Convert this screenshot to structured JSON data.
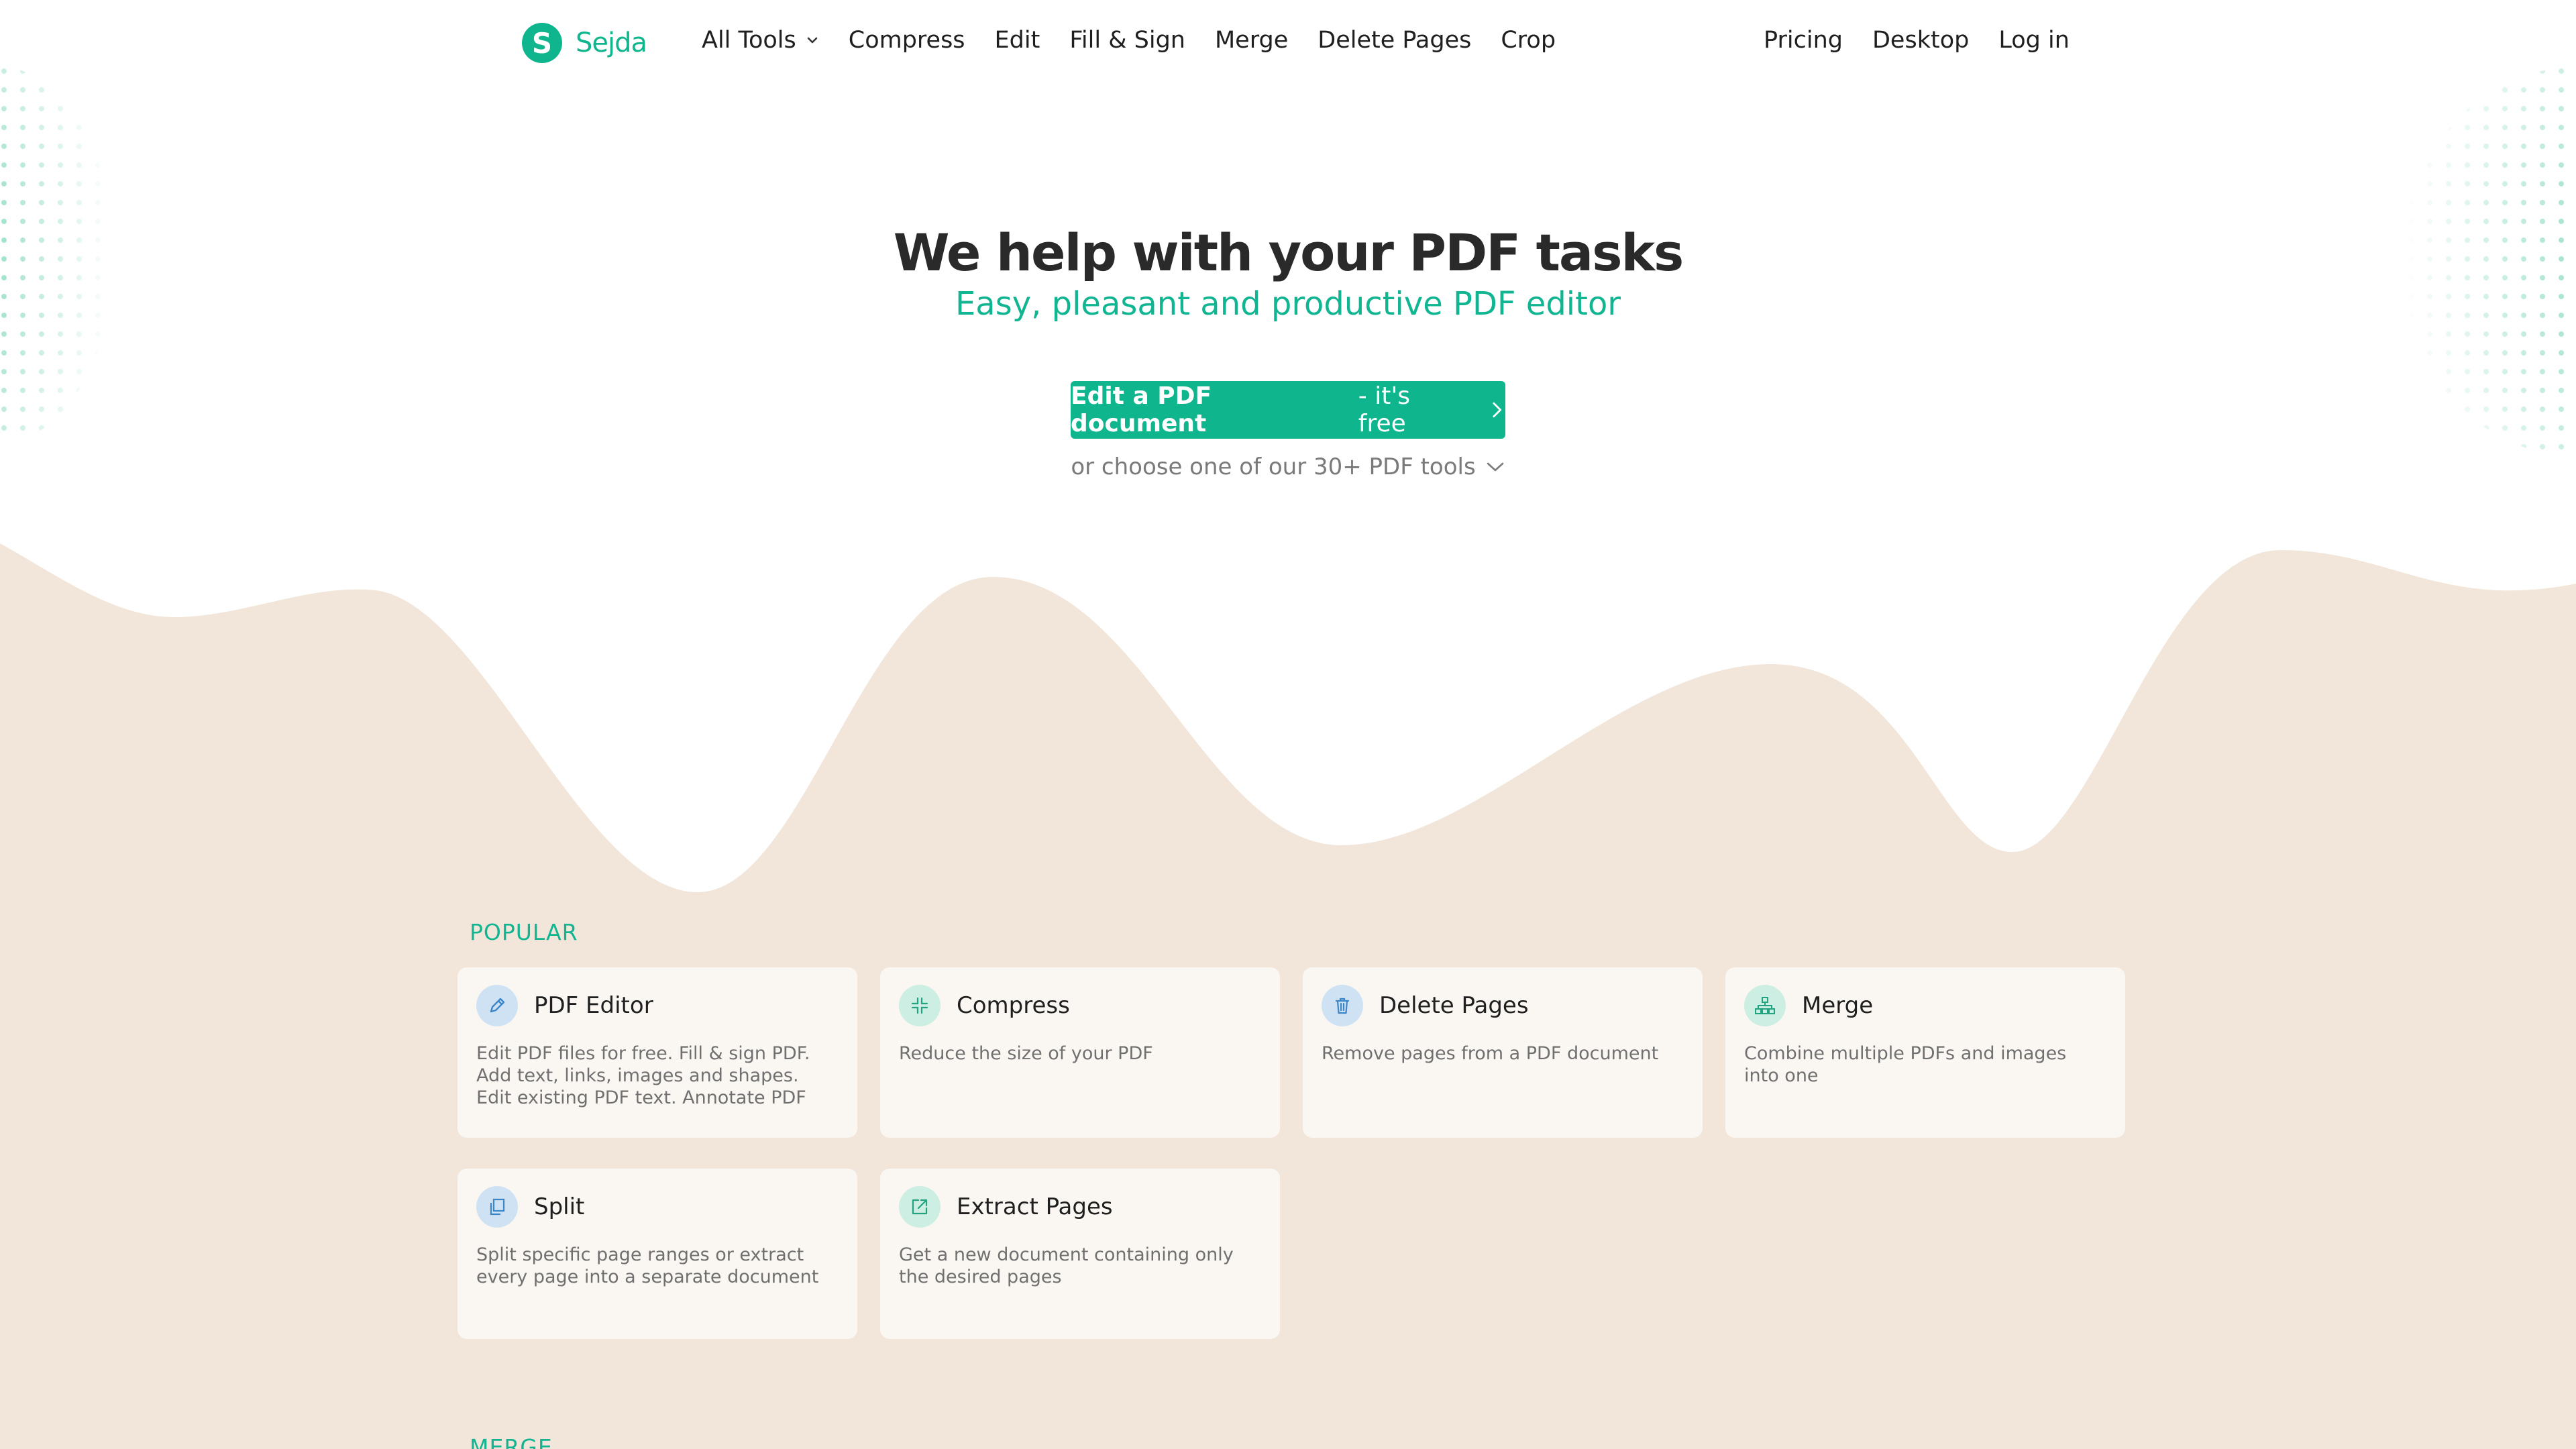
{
  "brand": {
    "name": "Sejda",
    "logo_letter": "S",
    "color": "#0fb58c"
  },
  "nav": {
    "items": [
      {
        "label": "All Tools"
      },
      {
        "label": "Compress"
      },
      {
        "label": "Edit"
      },
      {
        "label": "Fill & Sign"
      },
      {
        "label": "Merge"
      },
      {
        "label": "Delete Pages"
      },
      {
        "label": "Crop"
      }
    ],
    "right": [
      {
        "label": "Pricing"
      },
      {
        "label": "Desktop"
      },
      {
        "label": "Log in"
      }
    ]
  },
  "hero": {
    "title": "We help with your PDF tasks",
    "subtitle": "Easy, pleasant and productive PDF editor",
    "cta_bold": "Edit a PDF document",
    "cta_rest": "- it's free",
    "choose_text": "or choose one of our 30+ PDF tools"
  },
  "sections": [
    {
      "label": "POPULAR",
      "cards": [
        {
          "title": "PDF Editor",
          "desc": "Edit PDF files for free. Fill & sign PDF. Add text, links, images and shapes. Edit existing PDF text. Annotate PDF",
          "icon": "pencil-icon",
          "tone": "blue"
        },
        {
          "title": "Compress",
          "desc": "Reduce the size of your PDF",
          "icon": "compress-icon",
          "tone": "green"
        },
        {
          "title": "Delete Pages",
          "desc": "Remove pages from a PDF document",
          "icon": "trash-icon",
          "tone": "blue"
        },
        {
          "title": "Merge",
          "desc": "Combine multiple PDFs and images into one",
          "icon": "merge-icon",
          "tone": "green"
        },
        {
          "title": "Split",
          "desc": "Split specific page ranges or extract every page into a separate document",
          "icon": "split-icon",
          "tone": "blue"
        },
        {
          "title": "Extract Pages",
          "desc": "Get a new document containing only the desired pages",
          "icon": "extract-icon",
          "tone": "green"
        }
      ]
    },
    {
      "label": "MERGE"
    }
  ],
  "colors": {
    "accent": "#0fb58c",
    "wave": "#f2e5d9",
    "card": "#faf7f3",
    "heading": "#2a2a2a"
  }
}
